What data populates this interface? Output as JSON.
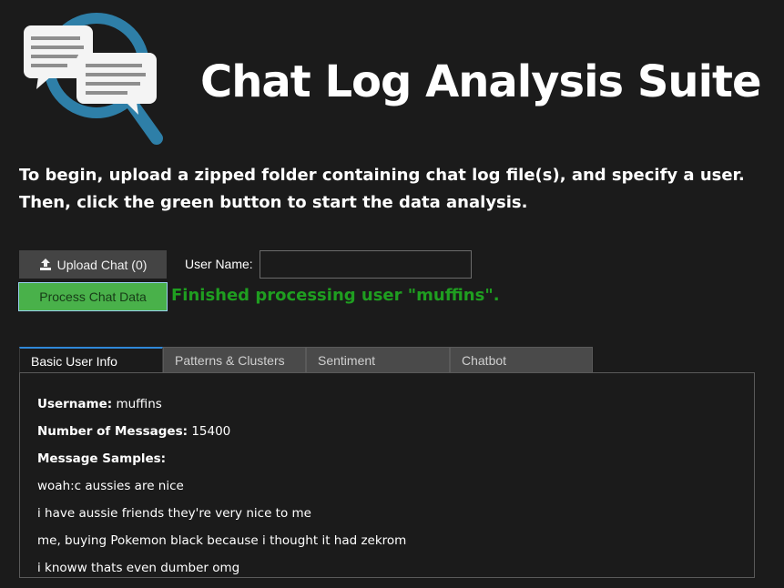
{
  "app": {
    "title": "Chat Log Analysis Suite"
  },
  "instructions": {
    "line1": "To begin, upload a zipped folder containing chat log file(s), and specify a user.",
    "line2": "Then, click the green button to start the data analysis."
  },
  "controls": {
    "upload_label": "Upload Chat (0)",
    "user_name_label": "User Name:",
    "user_name_value": "",
    "user_name_placeholder": "",
    "process_label": "Process Chat Data",
    "status": "Finished processing user \"muffins\"."
  },
  "tabs": [
    {
      "label": "Basic User Info",
      "active": true
    },
    {
      "label": "Patterns & Clusters",
      "active": false
    },
    {
      "label": "Sentiment",
      "active": false
    },
    {
      "label": "Chatbot",
      "active": false
    }
  ],
  "basic_info": {
    "username_label": "Username:",
    "username_value": "muffins",
    "messages_label": "Number of Messages:",
    "messages_value": "15400",
    "samples_label": "Message Samples:",
    "samples": [
      "woah:c aussies are nice",
      "i have aussie friends they're very nice to me",
      "me, buying Pokemon black because i thought it had zekrom",
      "i knoww thats even dumber omg"
    ]
  },
  "colors": {
    "background": "#1b1b1b",
    "accent_green": "#49b14a",
    "status_green": "#1f9e20",
    "tab_active_border": "#2f88d8",
    "logo_blue": "#2e7fa8"
  },
  "icons": {
    "logo": "magnifier-chat-bubbles-icon",
    "upload": "upload-icon"
  }
}
